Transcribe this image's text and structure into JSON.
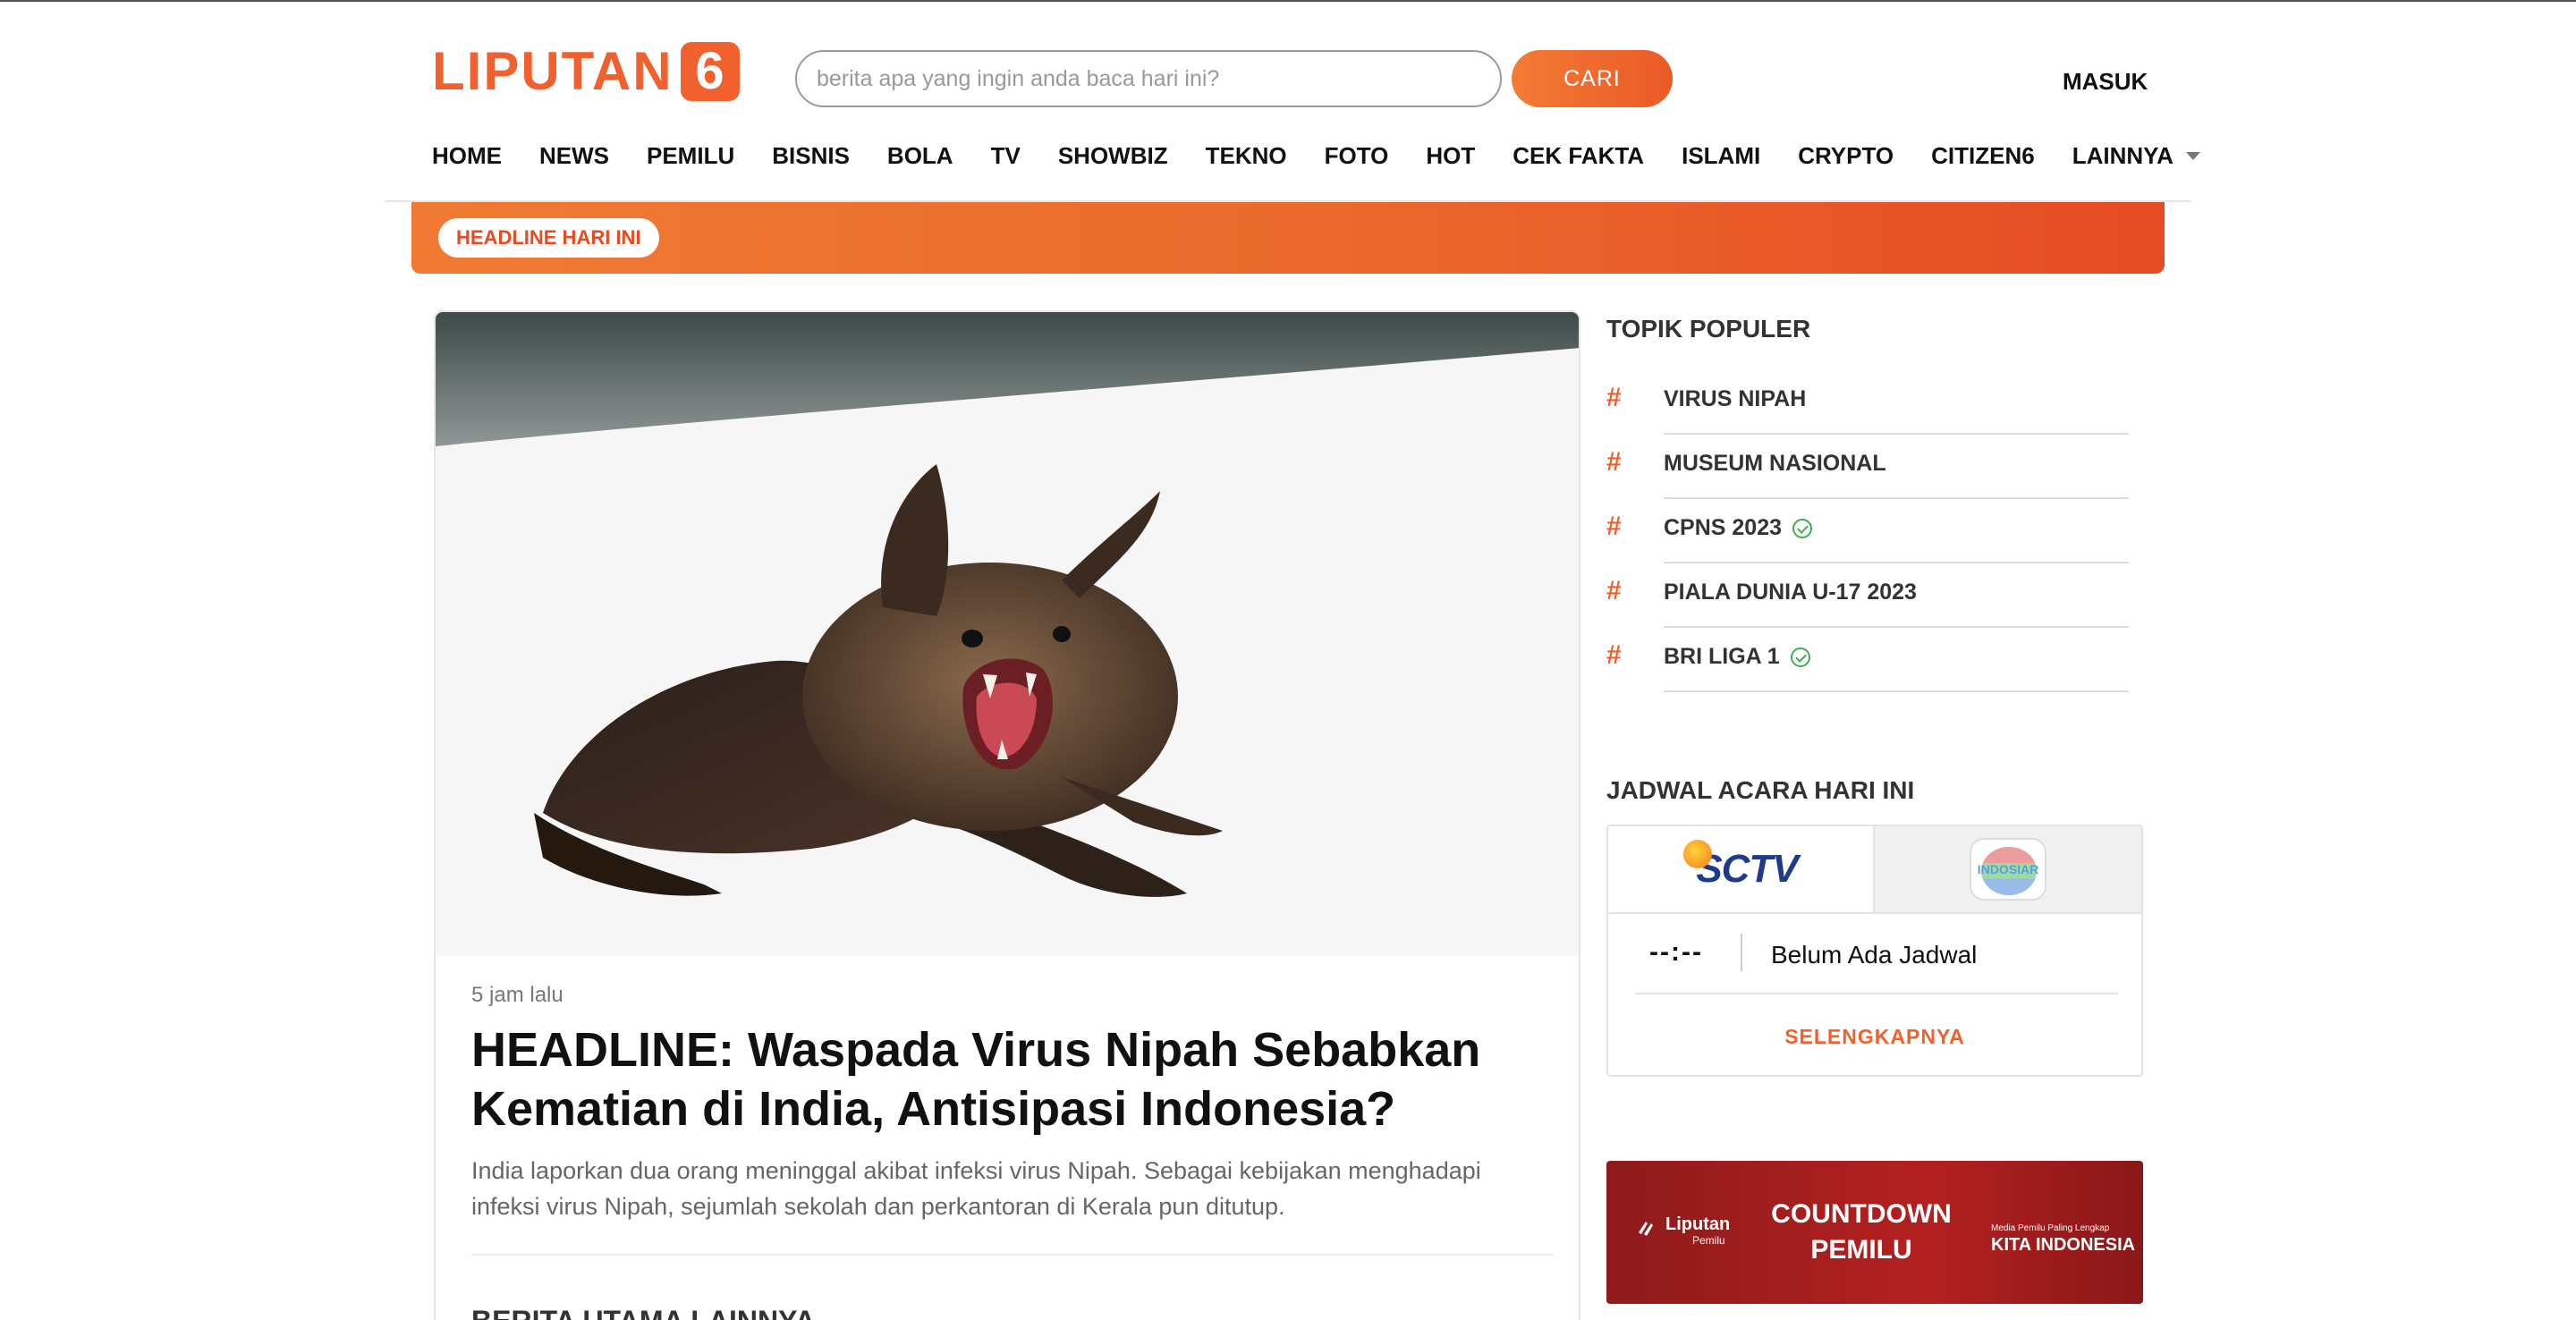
{
  "header": {
    "logo_text": "LIPUTAN",
    "logo_number": "6",
    "search_placeholder": "berita apa yang ingin anda baca hari ini?",
    "search_button": "CARI",
    "login": "MASUK"
  },
  "nav": {
    "items": [
      "HOME",
      "NEWS",
      "PEMILU",
      "BISNIS",
      "BOLA",
      "TV",
      "SHOWBIZ",
      "TEKNO",
      "FOTO",
      "HOT",
      "CEK FAKTA",
      "ISLAMI",
      "CRYPTO",
      "CITIZEN6"
    ],
    "more": "LAINNYA"
  },
  "headline_bar": {
    "label": "HEADLINE HARI INI"
  },
  "main_article": {
    "time": "5 jam lalu",
    "title": "HEADLINE: Waspada Virus Nipah Sebabkan Kematian di India, Antisipasi Indonesia?",
    "summary": "India laporkan dua orang meninggal akibat infeksi virus Nipah. Sebagai kebijakan menghadapi infeksi virus Nipah, sejumlah sekolah dan perkantoran di Kerala pun ditutup.",
    "more_title": "BERITA UTAMA LAINNYA"
  },
  "popular": {
    "title": "TOPIK POPULER",
    "hash": "#",
    "topics": [
      {
        "label": "VIRUS NIPAH",
        "verified": false
      },
      {
        "label": "MUSEUM NASIONAL",
        "verified": false
      },
      {
        "label": "CPNS 2023",
        "verified": true
      },
      {
        "label": "PIALA DUNIA U-17 2023",
        "verified": false
      },
      {
        "label": "BRI LIGA 1",
        "verified": true
      }
    ]
  },
  "schedule": {
    "title": "JADWAL ACARA HARI INI",
    "channels": [
      "SCTV",
      "INDOSIAR"
    ],
    "time": "--:--",
    "label": "Belum Ada Jadwal",
    "more": "SELENGKAPNYA"
  },
  "promo": {
    "brand": "Liputan",
    "brand_sub": "Pemilu",
    "title": "COUNTDOWN PEMILU",
    "tagline_small": "Media Pemilu Paling Lengkap",
    "tagline": "KITA INDONESIA"
  },
  "colors": {
    "accent": "#f0612e",
    "check": "#3fae49",
    "promo": "#a81e1e"
  }
}
